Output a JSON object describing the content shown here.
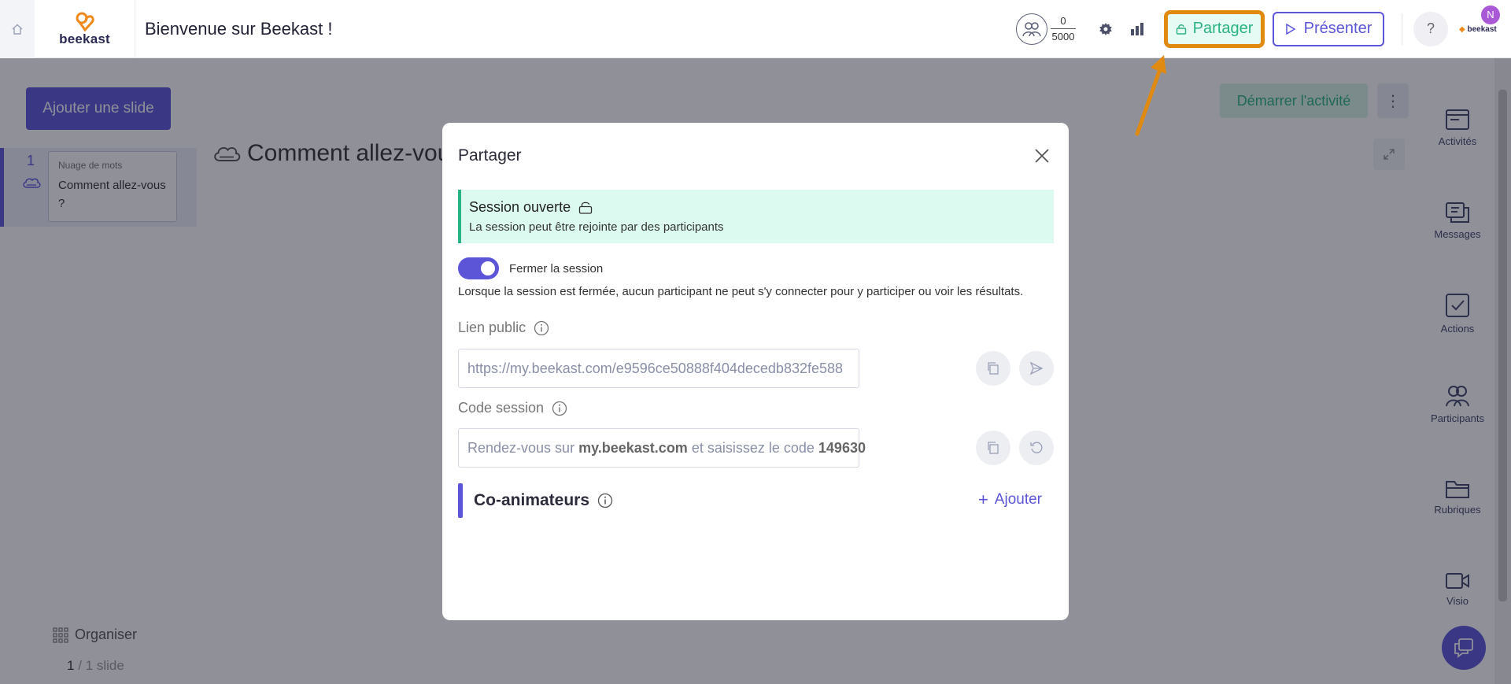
{
  "header": {
    "brand": "beekast",
    "title": "Bienvenue sur Beekast !",
    "participants_count": "0",
    "participants_max": "5000",
    "share_label": "Partager",
    "present_label": "Présenter",
    "help_label": "?",
    "avatar_initial": "N",
    "mini_brand": "beekast"
  },
  "left_panel": {
    "add_slide_label": "Ajouter une slide",
    "slides": [
      {
        "number": "1",
        "type": "Nuage de mots",
        "question": "Comment allez-vous ?"
      }
    ],
    "organise_label": "Organiser",
    "count_current": "1",
    "count_total": "/ 1 slide"
  },
  "main": {
    "slide_title": "Comment allez-vous ?",
    "start_label": "Démarrer l'activité",
    "more_label": "⋮"
  },
  "right_rail": {
    "items": [
      {
        "label": "Activités",
        "icon": "activities-icon"
      },
      {
        "label": "Messages",
        "icon": "messages-icon"
      },
      {
        "label": "Actions",
        "icon": "actions-icon"
      },
      {
        "label": "Participants",
        "icon": "participants-icon"
      },
      {
        "label": "Rubriques",
        "icon": "folder-icon"
      },
      {
        "label": "Visio",
        "icon": "video-icon"
      }
    ]
  },
  "modal": {
    "title": "Partager",
    "session_status_title": "Session ouverte",
    "session_status_desc": "La session peut être rejointe par des participants",
    "toggle_label": "Fermer la session",
    "toggle_on": true,
    "toggle_desc": "Lorsque la session est fermée, aucun participant ne peut s'y connecter pour y participer ou voir les résultats.",
    "public_link_label": "Lien public",
    "public_link_value": "https://my.beekast.com/e9596ce50888f404decedb832fe588",
    "session_code_label": "Code session",
    "code_text_prefix": "Rendez-vous sur ",
    "code_text_site": "my.beekast.com",
    "code_text_middle": " et saisissez le code ",
    "code_value": "149630",
    "coanim_label": "Co-animateurs",
    "add_label": "Ajouter"
  },
  "colors": {
    "accent": "#5c55d8",
    "success": "#2ab382",
    "highlight": "#e08a12"
  }
}
